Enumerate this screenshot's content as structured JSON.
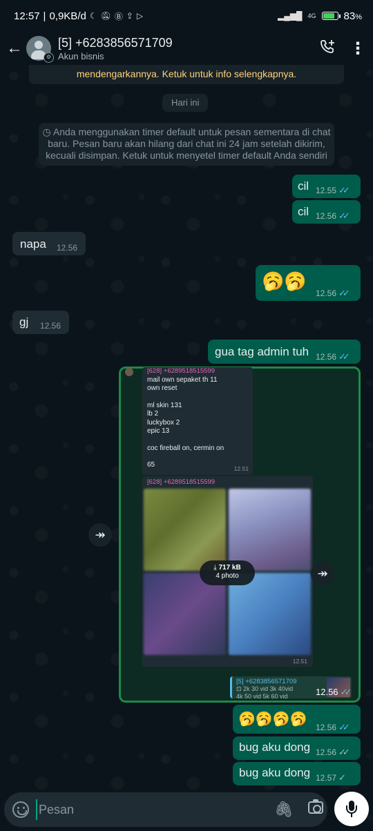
{
  "status_bar": {
    "time": "12:57",
    "net_speed": "0,9KB/d",
    "icons": [
      "moon-icon",
      "mute-icon",
      "b-icon",
      "upload-icon",
      "play-icon"
    ],
    "signal_label": "4G",
    "battery": "83",
    "battery_unit": "%",
    "battery_level": 0.83
  },
  "header": {
    "back_icon": "←",
    "title": "[5] +6283856571709",
    "subtitle": "Akun bisnis",
    "call_icon": "✆⁺",
    "menu_icon": "⋮"
  },
  "notice_top": "mendengarkannya. Ketuk untuk info selengkapnya.",
  "date_chip": "Hari ini",
  "timer_notice": {
    "icon": "◷",
    "line1": "Anda menggunakan timer default untuk pesan sementara di chat",
    "line2": "baru. Pesan baru akan hilang dari chat ini 24 jam setelah dikirim,",
    "line3": "kecuali disimpan. Ketuk untuk menyetel timer default Anda sendiri"
  },
  "messages": [
    {
      "text": "cil",
      "time": "12.55",
      "dir": "out",
      "status": "read"
    },
    {
      "text": "cil",
      "time": "12.56",
      "dir": "out",
      "status": "read"
    },
    {
      "text": "napa",
      "time": "12.56",
      "dir": "in"
    },
    {
      "text": "🥱🥱",
      "time": "12.56",
      "dir": "out",
      "status": "read"
    },
    {
      "text": "gj",
      "time": "12.56",
      "dir": "in"
    },
    {
      "text": "gua tag admin tuh",
      "time": "12.56",
      "dir": "out",
      "status": "read"
    },
    {
      "text": "🥱🥱🥱🥱",
      "time": "12.56",
      "dir": "out",
      "status": "read"
    },
    {
      "text": "bug aku dong",
      "time": "12.56",
      "dir": "out",
      "status": "delivered"
    },
    {
      "text": "bug aku dong",
      "time": "12.57",
      "dir": "out",
      "status": "sent"
    }
  ],
  "forward_card": {
    "forward_icon": "↠",
    "quote1": {
      "sender": "[628] +6289518515599",
      "lines": [
        "mail own sepaket th 11",
        "own reset",
        "",
        "ml skin 131",
        "lb 2",
        "luckybox 2",
        "epic 13",
        "",
        "coc fireball on, cermin on",
        "",
        "65"
      ],
      "time": "12.51"
    },
    "quote2": {
      "sender": "[628] +6289518515599",
      "download_icon": "⤓",
      "size": "717 kB",
      "count": "4 photo",
      "time": "12.51"
    },
    "quote3": {
      "sender": "[5] +6283856571709",
      "row1": "⊡ 2k 30 vid   3k 40vid",
      "row2": "4k 50 vid   5k 60 vid",
      "time": "12.56",
      "status": "read"
    }
  },
  "composer": {
    "placeholder": "Pesan",
    "attach_icon": "🖇",
    "camera_icon": "camera"
  }
}
